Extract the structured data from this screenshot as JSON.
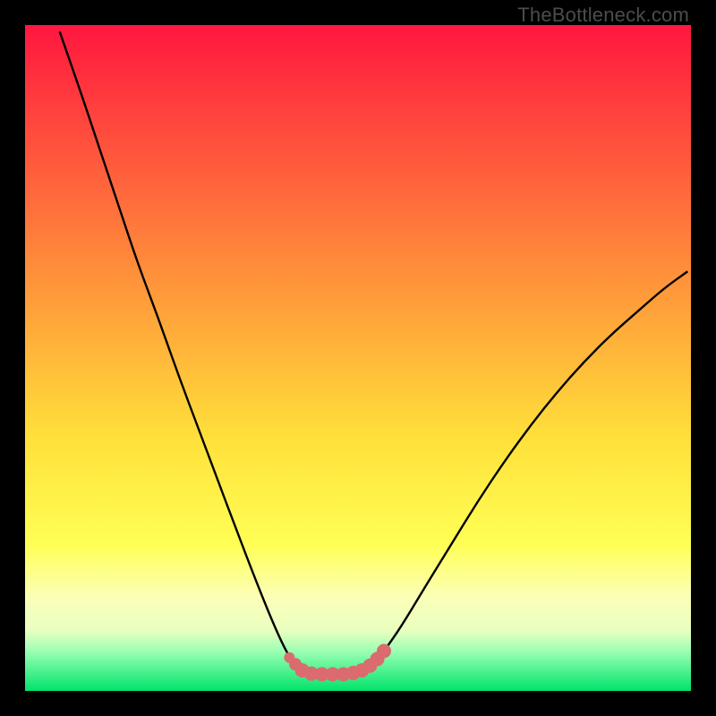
{
  "watermark": "TheBottleneck.com",
  "colors": {
    "frame_bg": "#000000",
    "curve": "#000000",
    "marker_fill": "#db6b6e",
    "marker_stroke": "#c45a5d",
    "grad_top": "#ff173f",
    "grad_mid1": "#ff7a3a",
    "grad_mid2": "#ffd53a",
    "grad_mid3": "#ffff66",
    "grad_low1": "#f6ffb0",
    "grad_low2": "#9cffb4",
    "grad_bottom": "#00e46a"
  },
  "chart_data": {
    "type": "line",
    "title": "",
    "xlabel": "",
    "ylabel": "",
    "xlim": [
      0,
      100
    ],
    "ylim": [
      0,
      100
    ],
    "curve": [
      {
        "x": 5.2,
        "y": 99.0
      },
      {
        "x": 8.0,
        "y": 91.0
      },
      {
        "x": 11.0,
        "y": 82.0
      },
      {
        "x": 14.0,
        "y": 73.0
      },
      {
        "x": 17.0,
        "y": 64.0
      },
      {
        "x": 20.0,
        "y": 56.0
      },
      {
        "x": 23.0,
        "y": 47.5
      },
      {
        "x": 26.0,
        "y": 39.5
      },
      {
        "x": 29.0,
        "y": 31.5
      },
      {
        "x": 32.0,
        "y": 23.5
      },
      {
        "x": 34.5,
        "y": 17.0
      },
      {
        "x": 36.5,
        "y": 12.0
      },
      {
        "x": 38.0,
        "y": 8.5
      },
      {
        "x": 39.2,
        "y": 6.0
      },
      {
        "x": 40.2,
        "y": 4.4
      },
      {
        "x": 41.5,
        "y": 3.3
      },
      {
        "x": 43.0,
        "y": 2.7
      },
      {
        "x": 45.0,
        "y": 2.5
      },
      {
        "x": 47.0,
        "y": 2.5
      },
      {
        "x": 49.0,
        "y": 2.7
      },
      {
        "x": 50.5,
        "y": 3.2
      },
      {
        "x": 52.0,
        "y": 4.1
      },
      {
        "x": 53.5,
        "y": 5.5
      },
      {
        "x": 55.0,
        "y": 7.5
      },
      {
        "x": 57.0,
        "y": 10.5
      },
      {
        "x": 60.0,
        "y": 15.5
      },
      {
        "x": 64.0,
        "y": 22.0
      },
      {
        "x": 68.0,
        "y": 28.5
      },
      {
        "x": 72.0,
        "y": 34.5
      },
      {
        "x": 76.0,
        "y": 40.0
      },
      {
        "x": 80.0,
        "y": 45.0
      },
      {
        "x": 84.0,
        "y": 49.5
      },
      {
        "x": 88.0,
        "y": 53.5
      },
      {
        "x": 92.0,
        "y": 57.0
      },
      {
        "x": 96.0,
        "y": 60.5
      },
      {
        "x": 99.5,
        "y": 63.0
      }
    ],
    "markers": [
      {
        "x": 39.7,
        "y": 5.0,
        "r": 6
      },
      {
        "x": 40.6,
        "y": 4.0,
        "r": 7
      },
      {
        "x": 41.6,
        "y": 3.1,
        "r": 8
      },
      {
        "x": 43.0,
        "y": 2.6,
        "r": 8
      },
      {
        "x": 44.6,
        "y": 2.5,
        "r": 8
      },
      {
        "x": 46.2,
        "y": 2.5,
        "r": 8
      },
      {
        "x": 47.8,
        "y": 2.5,
        "r": 8
      },
      {
        "x": 49.3,
        "y": 2.7,
        "r": 8
      },
      {
        "x": 50.6,
        "y": 3.1,
        "r": 8
      },
      {
        "x": 51.8,
        "y": 3.8,
        "r": 8
      },
      {
        "x": 52.9,
        "y": 4.8,
        "r": 8
      },
      {
        "x": 53.9,
        "y": 6.0,
        "r": 8
      }
    ],
    "gradient_bands_pct_from_top": [
      {
        "stop": 0,
        "color": "#ff173f"
      },
      {
        "stop": 38,
        "color": "#ff923a"
      },
      {
        "stop": 62,
        "color": "#ffe03a"
      },
      {
        "stop": 78,
        "color": "#ffff55"
      },
      {
        "stop": 86,
        "color": "#fbffb8"
      },
      {
        "stop": 91,
        "color": "#e8ffc0"
      },
      {
        "stop": 94,
        "color": "#9cffb4"
      },
      {
        "stop": 100,
        "color": "#00e46a"
      }
    ]
  }
}
